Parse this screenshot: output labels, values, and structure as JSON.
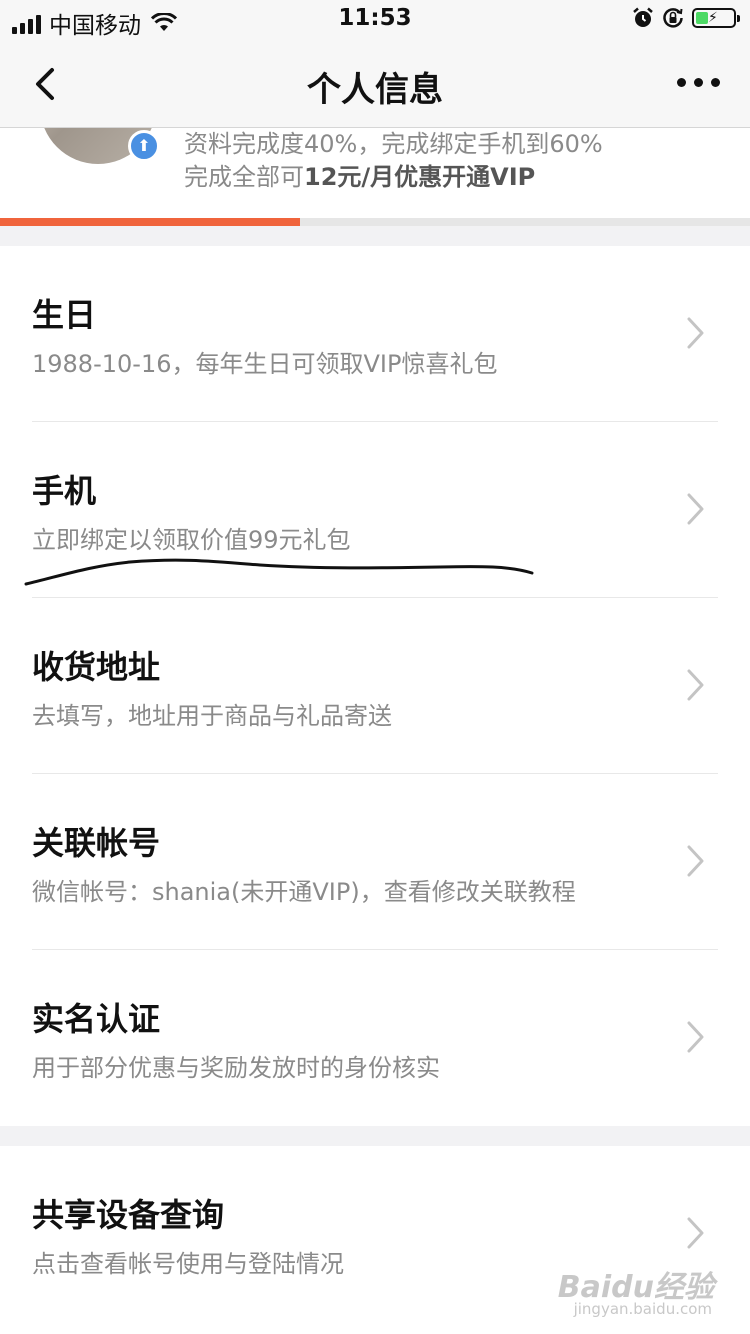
{
  "status_bar": {
    "carrier": "中国移动",
    "time": "11:53"
  },
  "nav": {
    "title": "个人信息"
  },
  "profile": {
    "progress_line1": "资料完成度40%，完成绑定手机到60%",
    "progress_line2_prefix": "完成全部可",
    "progress_line2_bold": "12元/月优惠开通VIP",
    "completion": 0.4
  },
  "rows": [
    {
      "title": "生日",
      "subtitle": "1988-10-16，每年生日可领取VIP惊喜礼包"
    },
    {
      "title": "手机",
      "subtitle": "立即绑定以领取价值99元礼包"
    },
    {
      "title": "收货地址",
      "subtitle": "去填写，地址用于商品与礼品寄送"
    },
    {
      "title": "关联帐号",
      "subtitle": "微信帐号：shania(未开通VIP)，查看修改关联教程"
    },
    {
      "title": "实名认证",
      "subtitle": "用于部分优惠与奖励发放时的身份核实"
    }
  ],
  "rows_group2": [
    {
      "title": "共享设备查询",
      "subtitle": "点击查看帐号使用与登陆情况"
    }
  ],
  "watermark": {
    "text": "Baidu经验",
    "sub": "jingyan.baidu.com"
  },
  "colors": {
    "accent": "#f0643c",
    "badge": "#4a90e2"
  }
}
